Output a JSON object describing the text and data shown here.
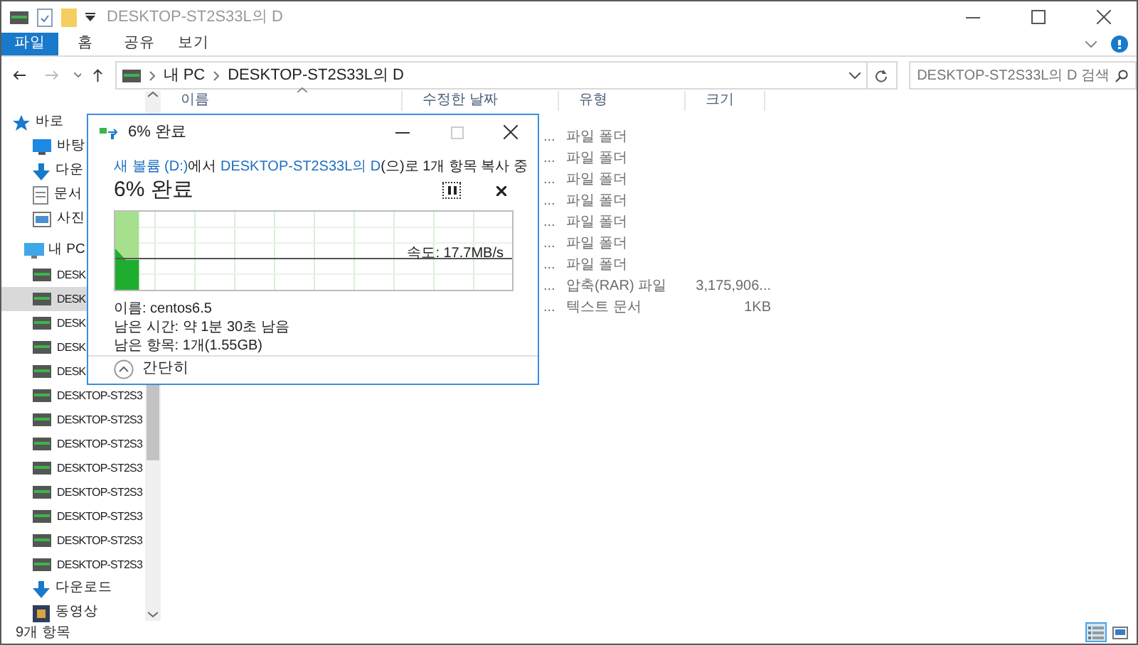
{
  "window": {
    "title": "DESKTOP-ST2S33L의 D"
  },
  "ribbon_tabs": [
    {
      "label": "파일",
      "selected": true
    },
    {
      "label": "홈",
      "selected": false
    },
    {
      "label": "공유",
      "selected": false
    },
    {
      "label": "보기",
      "selected": false
    }
  ],
  "address_bar": {
    "path": [
      "내 PC",
      "DESKTOP-ST2S33L의 D"
    ]
  },
  "search": {
    "placeholder": "DESKTOP-ST2S33L의 D 검색"
  },
  "sidebar": {
    "items": [
      {
        "kind": "star",
        "label": "바로",
        "selected": false
      },
      {
        "kind": "desktop",
        "label": "바탕",
        "selected": false
      },
      {
        "kind": "download",
        "label": "다운",
        "selected": false
      },
      {
        "kind": "documents",
        "label": "문서",
        "selected": false
      },
      {
        "kind": "pictures",
        "label": "사진",
        "selected": false
      },
      {
        "kind": "pc",
        "label": "내 PC",
        "selected": false
      },
      {
        "kind": "drive",
        "label": "DESK",
        "selected": false
      },
      {
        "kind": "drive",
        "label": "DESK",
        "selected": true
      },
      {
        "kind": "drive",
        "label": "DESK",
        "selected": false
      },
      {
        "kind": "drive",
        "label": "DESK",
        "selected": false
      },
      {
        "kind": "drive",
        "label": "DESK",
        "selected": false
      },
      {
        "kind": "drive",
        "label": "DESKTOP-ST2S3",
        "selected": false
      },
      {
        "kind": "drive",
        "label": "DESKTOP-ST2S3",
        "selected": false
      },
      {
        "kind": "drive",
        "label": "DESKTOP-ST2S3",
        "selected": false
      },
      {
        "kind": "drive",
        "label": "DESKTOP-ST2S3",
        "selected": false
      },
      {
        "kind": "drive",
        "label": "DESKTOP-ST2S3",
        "selected": false
      },
      {
        "kind": "drive",
        "label": "DESKTOP-ST2S3",
        "selected": false
      },
      {
        "kind": "drive",
        "label": "DESKTOP-ST2S3",
        "selected": false
      },
      {
        "kind": "drive",
        "label": "DESKTOP-ST2S3",
        "selected": false
      },
      {
        "kind": "download",
        "label": "다운로드",
        "selected": false
      },
      {
        "kind": "video",
        "label": "동영상",
        "selected": false
      }
    ]
  },
  "columns": [
    "이름",
    "수정한 날짜",
    "유형",
    "크기"
  ],
  "rows": [
    {
      "date": "...",
      "type": "파일 폴더"
    },
    {
      "date": "...",
      "type": "파일 폴더"
    },
    {
      "date": "...",
      "type": "파일 폴더"
    },
    {
      "date": "...",
      "type": "파일 폴더"
    },
    {
      "date": "...",
      "type": "파일 폴더"
    },
    {
      "date": "...",
      "type": "파일 폴더"
    },
    {
      "date": "...",
      "type": "파일 폴더"
    },
    {
      "date": "...",
      "type": "압축(RAR) 파일",
      "size": "3,175,906..."
    },
    {
      "date": "...",
      "type": "텍스트 문서",
      "size": "1KB"
    }
  ],
  "status_bar": {
    "text": "9개 항목"
  },
  "view_buttons": [
    {
      "kind": "details",
      "selected": true
    },
    {
      "kind": "large_icons",
      "selected": false
    }
  ],
  "dialog": {
    "title": "6% 완료",
    "source": [
      {
        "kind": "link",
        "text": "새 볼륨 (D:)"
      },
      {
        "kind": "text",
        "text": "에서 "
      },
      {
        "kind": "link",
        "text": "DESKTOP-ST2S33L의 D"
      },
      {
        "kind": "text",
        "text": "(으)로 1개 항목 복사 중"
      }
    ],
    "heading": "6% 완료",
    "progress": {
      "level": 0.06
    },
    "speed": "속도: 17.7MB/s",
    "details": [
      "이름: centos6.5",
      "남은 시간: 약 1분 30초 남음",
      "남은 항목: 1개(1.55GB)"
    ],
    "toggle": "간단히"
  }
}
